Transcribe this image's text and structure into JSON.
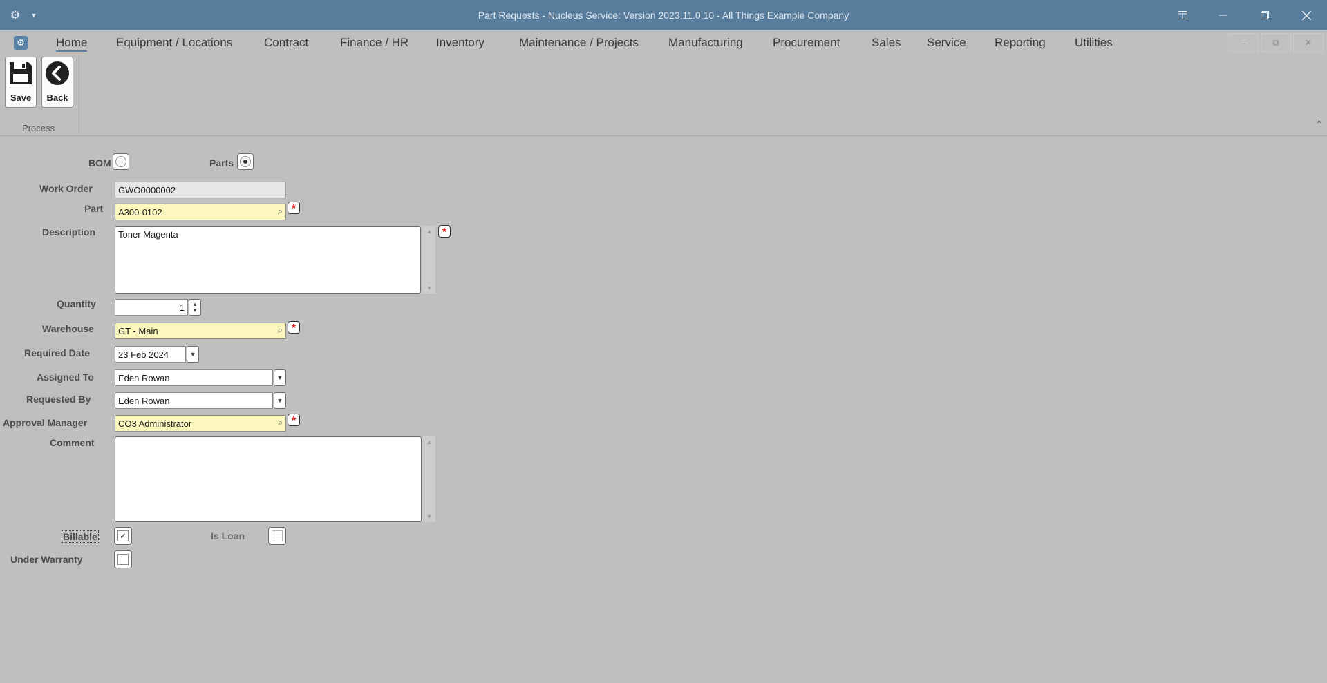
{
  "window": {
    "title": "Part Requests - Nucleus Service: Version 2023.11.0.10 - All Things Example Company",
    "icons": [
      "gear-icon",
      "chevron-down-icon",
      "layout-icon",
      "minimize-icon",
      "restore-icon",
      "close-icon"
    ]
  },
  "menu": {
    "items": [
      "Home",
      "Equipment / Locations",
      "Contract",
      "Finance / HR",
      "Inventory",
      "Maintenance / Projects",
      "Manufacturing",
      "Procurement",
      "Sales",
      "Service",
      "Reporting",
      "Utilities"
    ],
    "active": "Home",
    "mdi_minimize": "–",
    "mdi_restore": "⧉",
    "mdi_close": "✕"
  },
  "ribbon": {
    "save_label": "Save",
    "back_label": "Back",
    "group_label": "Process",
    "collapse_glyph": "⌃"
  },
  "form": {
    "bom_label": "BOM",
    "parts_label": "Parts",
    "selected_mode": "Parts",
    "work_order_label": "Work Order",
    "work_order_value": "GWO0000002",
    "part_label": "Part",
    "part_value": "A300-0102",
    "description_label": "Description",
    "description_value": "Toner Magenta",
    "quantity_label": "Quantity",
    "quantity_value": "1",
    "warehouse_label": "Warehouse",
    "warehouse_value": "GT - Main",
    "required_date_label": "Required Date",
    "required_date_value": "23 Feb 2024",
    "assigned_to_label": "Assigned To",
    "assigned_to_value": "Eden Rowan",
    "requested_by_label": "Requested By",
    "requested_by_value": "Eden Rowan",
    "approval_manager_label": "Approval Manager",
    "approval_manager_value": "CO3 Administrator",
    "comment_label": "Comment",
    "comment_value": "",
    "billable_label": "Billable",
    "billable_checked": true,
    "is_loan_label": "Is Loan",
    "is_loan_checked": false,
    "under_warranty_label": "Under Warranty",
    "under_warranty_checked": false,
    "required_marker": "*",
    "check_glyph": "✓",
    "lookup_glyph": "⌕"
  }
}
